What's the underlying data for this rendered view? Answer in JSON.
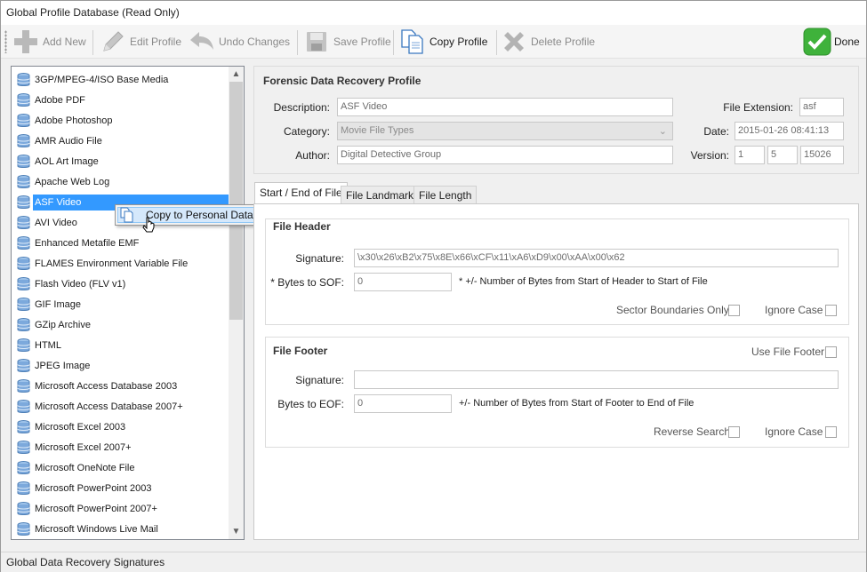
{
  "window": {
    "title": "Global Profile Database (Read Only)"
  },
  "toolbar": {
    "add_new": "Add New",
    "edit_profile": "Edit Profile",
    "undo_changes": "Undo Changes",
    "save_profile": "Save Profile",
    "copy_profile": "Copy Profile",
    "delete_profile": "Delete Profile",
    "done": "Done"
  },
  "profiles": [
    "3GP/MPEG-4/ISO Base Media",
    "Adobe PDF",
    "Adobe Photoshop",
    "AMR Audio File",
    "AOL Art Image",
    "Apache Web Log",
    "ASF Video",
    "AVI Video",
    "Enhanced Metafile EMF",
    "FLAMES Environment Variable File",
    "Flash Video (FLV v1)",
    "GIF Image",
    "GZip Archive",
    "HTML",
    "JPEG Image",
    "Microsoft Access Database 2003",
    "Microsoft Access Database 2007+",
    "Microsoft Excel 2003",
    "Microsoft Excel 2007+",
    "Microsoft OneNote File",
    "Microsoft PowerPoint 2003",
    "Microsoft PowerPoint 2007+",
    "Microsoft Windows Live Mail"
  ],
  "selected_profile": "ASF Video",
  "context_menu": {
    "copy_to_personal": "Copy to Personal  Database"
  },
  "profile": {
    "section_title": "Forensic Data Recovery Profile",
    "description_label": "Description:",
    "description": "ASF Video",
    "category_label": "Category:",
    "category": "Movie File Types",
    "author_label": "Author:",
    "author": "Digital Detective Group",
    "extension_label": "File Extension:",
    "extension": "asf",
    "date_label": "Date:",
    "date": "2015-01-26 08:41:13",
    "version_label": "Version:",
    "version_major": "1",
    "version_minor": "5",
    "version_build": "15026"
  },
  "tabs": [
    "Start / End of File",
    "File Landmarks",
    "File Length"
  ],
  "header": {
    "title": "File Header",
    "signature_label": "Signature:",
    "signature": "\\x30\\x26\\xB2\\x75\\x8E\\x66\\xCF\\x11\\xA6\\xD9\\x00\\xAA\\x00\\x62",
    "bytes_label": "* Bytes to SOF:",
    "bytes_value": "0",
    "bytes_note": "* +/- Number of Bytes from Start of Header to Start of File",
    "sector_label": "Sector Boundaries Only",
    "ignore_case_label": "Ignore Case"
  },
  "footer": {
    "title": "File Footer",
    "use_footer_label": "Use File Footer",
    "signature_label": "Signature:",
    "signature": "",
    "bytes_label": "Bytes to EOF:",
    "bytes_value": "0",
    "bytes_note": "+/- Number of Bytes from Start of Footer to End of File",
    "reverse_label": "Reverse Search",
    "ignore_case_label": "Ignore Case"
  },
  "status": {
    "text": "Global Data Recovery Signatures"
  },
  "colors": {
    "selection": "#3399ff",
    "done_green": "#3fb23b"
  }
}
